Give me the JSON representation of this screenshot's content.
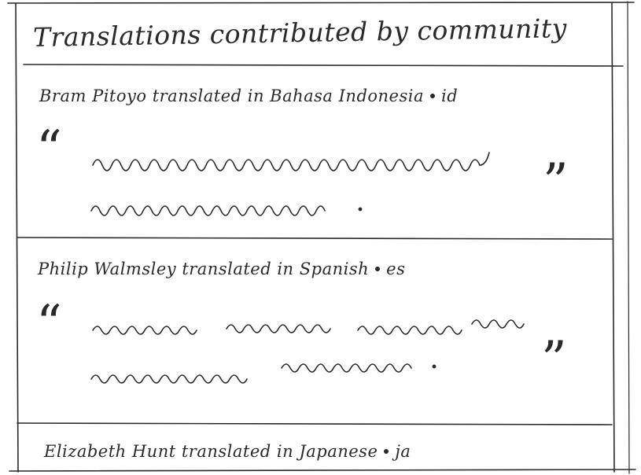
{
  "title": "Translations contributed by community",
  "entries": [
    {
      "translator": "Bram Pitoyo",
      "verb": "translated in",
      "language": "Bahasa Indonesia",
      "code": "id"
    },
    {
      "translator": "Philip Walmsley",
      "verb": "translated in",
      "language": "Spanish",
      "code": "es"
    },
    {
      "translator": "Elizabeth Hunt",
      "verb": "translated in",
      "language": "Japanese",
      "code": "ja"
    }
  ],
  "icons": {
    "open_quote": "open-quote-icon",
    "close_quote": "close-quote-icon"
  },
  "colors": {
    "ink": "#2a2a2a",
    "paper": "#ffffff"
  }
}
